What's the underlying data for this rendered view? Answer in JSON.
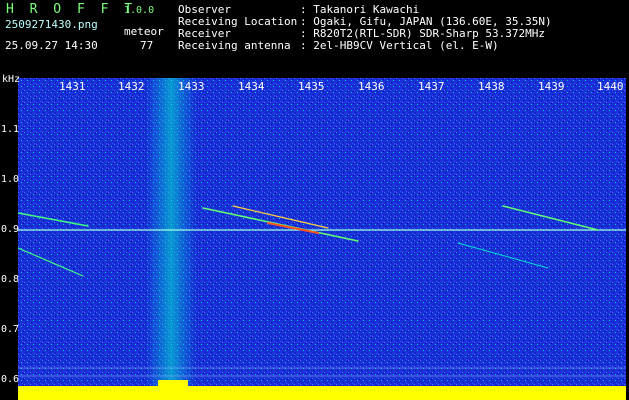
{
  "header": {
    "app_name": "H R O F F T",
    "version": "1.0.0",
    "filename": "2509271430.png",
    "datetime": "25.09.27 14:30",
    "meteor_label": "meteor",
    "meteor_count": "77",
    "info": [
      {
        "key": "Observer",
        "value": ": Takanori Kawachi"
      },
      {
        "key": "Receiving Location",
        "value": ": Ogaki, Gifu, JAPAN (136.60E, 35.35N)"
      },
      {
        "key": "Receiver",
        "value": ": R820T2(RTL-SDR) SDR-Sharp 53.372MHz"
      },
      {
        "key": "Receiving antenna",
        "value": ": 2el-HB9CV Vertical (el. E-W)"
      }
    ]
  },
  "axis": {
    "unit": "kHz",
    "x_ticks": [
      "1431",
      "1432",
      "1433",
      "1434",
      "1435",
      "1436",
      "1437",
      "1438",
      "1439",
      "1440"
    ],
    "y_ticks": [
      "1.1",
      "1.0",
      "0.9",
      "0.8",
      "0.7",
      "0.6"
    ]
  },
  "colors": {
    "background_noise": "#1a2fd8",
    "signal": "#00e0d0",
    "power_bar": "#ffff00",
    "text_green": "#4dff4d"
  }
}
